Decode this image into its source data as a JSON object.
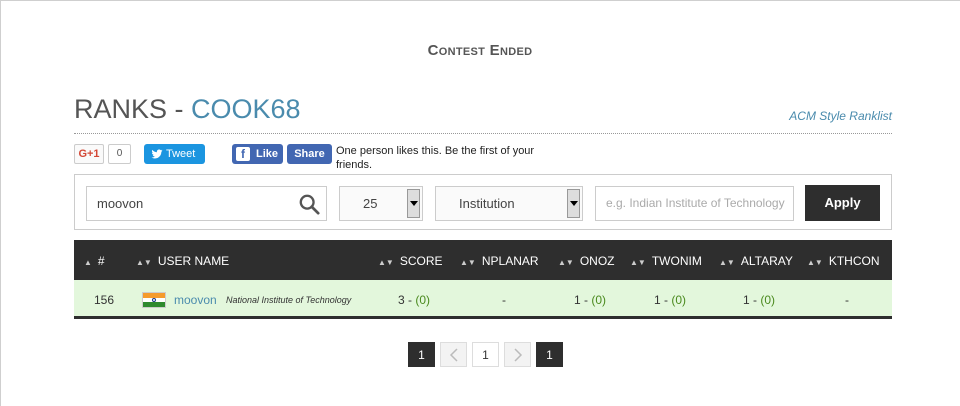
{
  "status": "Contest Ended",
  "header": {
    "title_prefix": "RANKS - ",
    "contest_code": "COOK68",
    "acm_link": "ACM Style Ranklist"
  },
  "social": {
    "gplus_label": "G+1",
    "gplus_count": "0",
    "tweet_label": "Tweet",
    "fb_like_label": "Like",
    "fb_share_label": "Share",
    "fb_text": "One person likes this. Be the first of your friends."
  },
  "filters": {
    "search_value": "moovon",
    "per_page": "25",
    "institution_select": "Institution",
    "institution_placeholder": "e.g. Indian Institute of Technology",
    "apply_label": "Apply"
  },
  "table": {
    "columns": [
      "#",
      "USER NAME",
      "SCORE",
      "NPLANAR",
      "ONOZ",
      "TWONIM",
      "ALTARAY",
      "KTHCON"
    ],
    "rows": [
      {
        "rank": "156",
        "username": "moovon",
        "institution": "National Institute of Technology",
        "score_total": "3",
        "score_penalty": "(0)",
        "nplanar": "-",
        "onoz_total": "1",
        "onoz_penalty": "(0)",
        "twonim_total": "1",
        "twonim_penalty": "(0)",
        "altaray_total": "1",
        "altaray_penalty": "(0)",
        "kthcon": "-"
      }
    ]
  },
  "pagination": {
    "first": "1",
    "current": "1",
    "last": "1"
  },
  "colors": {
    "accent": "#4a8bad",
    "dark": "#2e2e2e",
    "row_highlight": "#e3f7dc",
    "score_green": "#4a8a1e"
  }
}
